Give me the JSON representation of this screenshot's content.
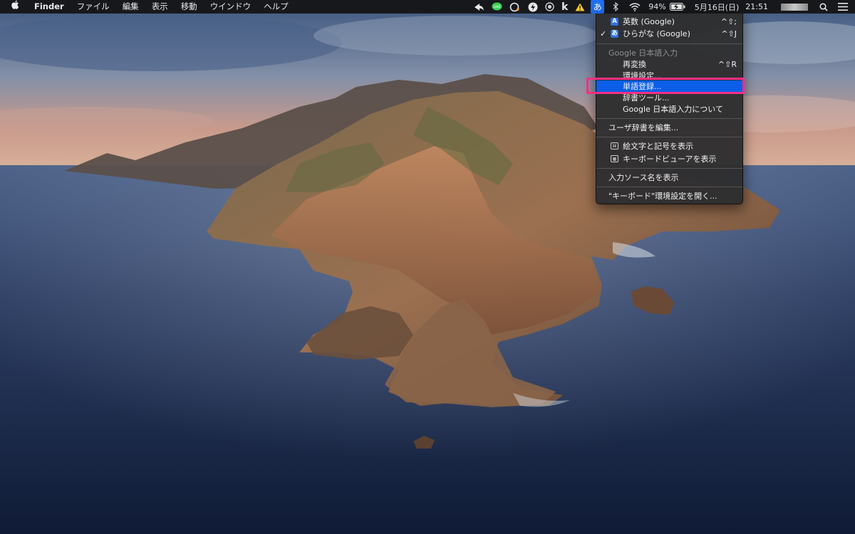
{
  "menubar": {
    "app_name": "Finder",
    "menus": [
      "ファイル",
      "編集",
      "表示",
      "移動",
      "ウインドウ",
      "ヘルプ"
    ],
    "battery": "94%",
    "date": "5月16日(日)",
    "time": "21:51",
    "ime_indicator": "あ"
  },
  "dropdown": {
    "items": [
      {
        "label": "英数 (Google)",
        "shortcut": "^⇧;",
        "icon": "A"
      },
      {
        "label": "ひらがな (Google)",
        "shortcut": "^⇧J",
        "icon": "あ",
        "check": "✓"
      },
      {
        "label": "Google 日本語入力"
      },
      {
        "label": "再変換",
        "shortcut": "^⇧R"
      },
      {
        "label": "環境設定..."
      },
      {
        "label": "単語登録..."
      },
      {
        "label": "辞書ツール..."
      },
      {
        "label": "Google 日本語入力について"
      },
      {
        "label": "ユーザ辞書を編集..."
      },
      {
        "label": "絵文字と記号を表示"
      },
      {
        "label": "キーボードビューアを表示"
      },
      {
        "label": "入力ソース名を表示"
      },
      {
        "label": "\"キーボード\"環境設定を開く..."
      }
    ]
  },
  "colors": {
    "highlight": "#0a5ee8",
    "annotation": "#ff2e86",
    "ime_selected": "#1d6ff2"
  },
  "icons": {
    "apple": "apple-icon",
    "wifi": "wifi-icon",
    "battery": "battery-charging-icon",
    "search": "search-icon",
    "control_center": "control-center-icon"
  }
}
